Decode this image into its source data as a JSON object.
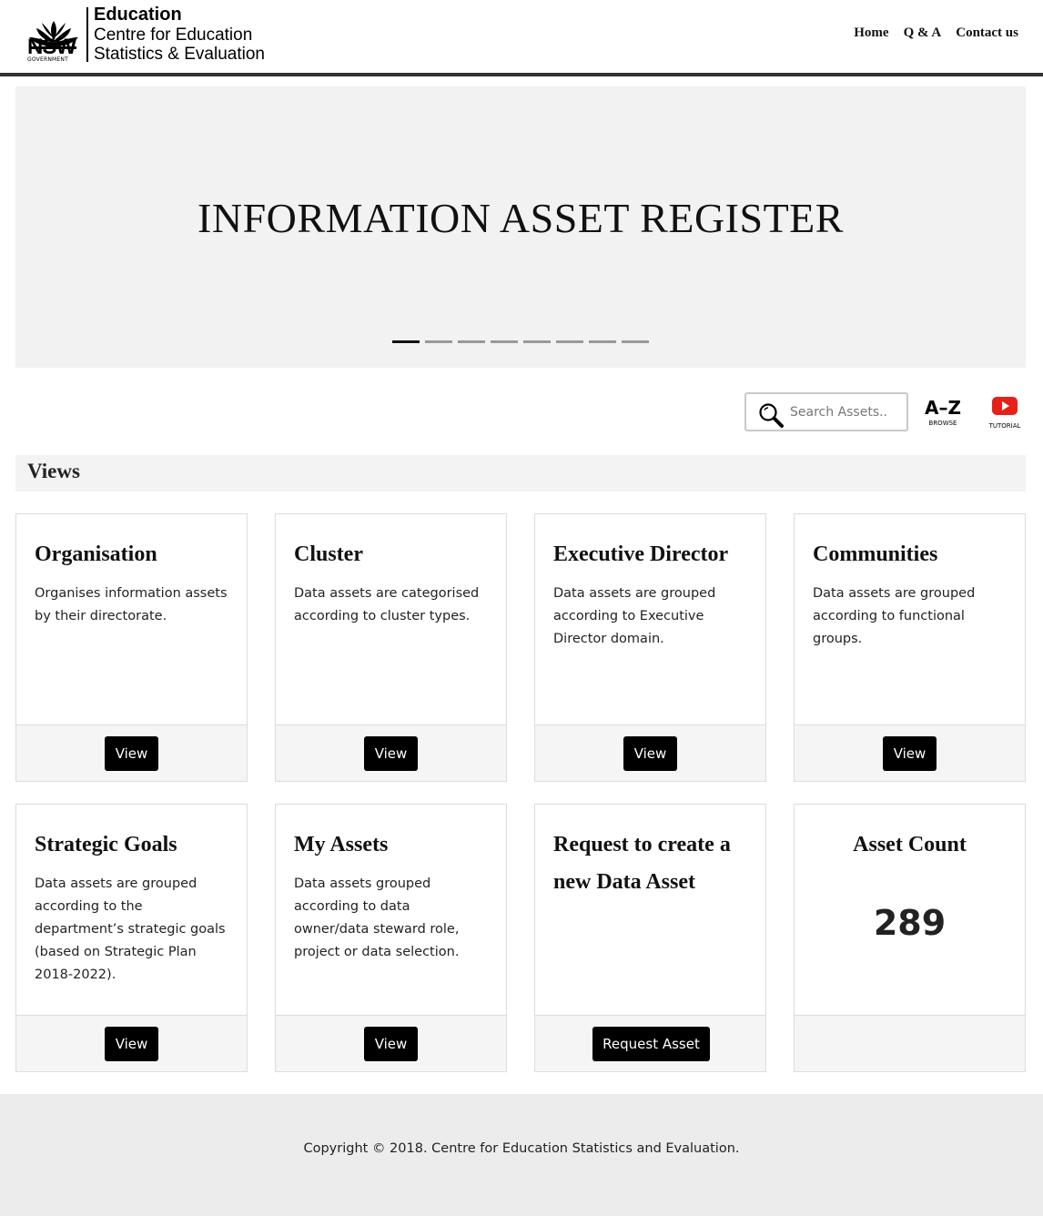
{
  "header": {
    "logo": {
      "nsw": "NSW",
      "government": "GOVERNMENT",
      "line1": "Education",
      "line2": "Centre for Education",
      "line3": "Statistics & Evaluation"
    },
    "nav": [
      {
        "label": "Home"
      },
      {
        "label": "Q & A"
      },
      {
        "label": "Contact us"
      }
    ]
  },
  "hero": {
    "title": "INFORMATION ASSET REGISTER",
    "slides_total": 8,
    "active_slide": 1
  },
  "tools": {
    "search_placeholder": "Search Assets..",
    "az_label": "A–Z",
    "az_sub": "BROWSE",
    "tutorial_sub": "TUTORIAL"
  },
  "views": {
    "title": "Views",
    "cards": [
      {
        "title": "Organisation",
        "desc": "Organises information assets by their directorate.",
        "button": "View"
      },
      {
        "title": "Cluster",
        "desc": "Data assets are categorised according to cluster types.",
        "button": "View"
      },
      {
        "title": "Executive Director",
        "desc": "Data assets are grouped according to Executive Director domain.",
        "button": "View"
      },
      {
        "title": "Communities",
        "desc": "Data assets are grouped according to functional groups.",
        "button": "View"
      },
      {
        "title": "Strategic Goals",
        "desc": "Data assets are grouped according to the department’s strategic goals (based on Strategic Plan 2018-2022).",
        "button": "View"
      },
      {
        "title": "My Assets",
        "desc": "Data assets grouped according to data owner/data steward role, project or data selection.",
        "button": "View"
      },
      {
        "title": "Request to create a new Data Asset",
        "desc": "",
        "button": "Request Asset"
      }
    ],
    "asset_count": {
      "title": "Asset Count",
      "value": "289"
    }
  },
  "footer": {
    "copyright": "Copyright © 2018. Centre for Education Statistics and Evaluation."
  },
  "colors": {
    "button_bg": "#000000",
    "hero_bg": "#f2f2f2",
    "footer_bg": "#ececec",
    "youtube_red": "#e62117"
  }
}
